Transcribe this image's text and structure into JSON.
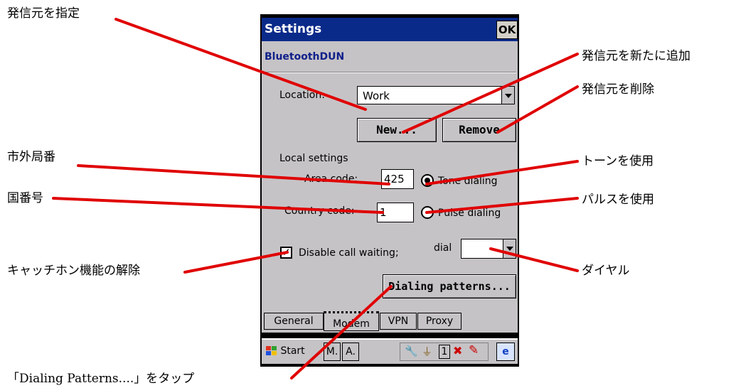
{
  "window": {
    "title": "Settings",
    "ok_label": "OK"
  },
  "connection_name": "BluetoothDUN",
  "location": {
    "label": "Location:",
    "value": "Work"
  },
  "buttons": {
    "new_label": "New...",
    "remove_label": "Remove",
    "dialing_patterns_label": "Dialing patterns..."
  },
  "local_settings": {
    "heading": "Local settings",
    "area_code_label": "Area code:",
    "area_code_value": "425",
    "country_code_label": "Country code:",
    "country_code_value": "1",
    "tone_label": "Tone dialing",
    "pulse_label": "Pulse dialing",
    "tone_selected": true
  },
  "call_waiting": {
    "label": "Disable call waiting;",
    "checked": true,
    "dial_label": "dial",
    "dial_value": ""
  },
  "tabs": [
    {
      "label": "General",
      "active": false
    },
    {
      "label": "Modem",
      "active": true
    },
    {
      "label": "VPN",
      "active": false
    },
    {
      "label": "Proxy",
      "active": false
    }
  ],
  "taskbar": {
    "start_label": "Start",
    "m_label": "M.",
    "a_label": "A.",
    "tray_number": "1"
  },
  "annotations": {
    "location_select": "発信元を指定",
    "new_location": "発信元を新たに追加",
    "remove_location": "発信元を削除",
    "area_code": "市外局番",
    "tone": "トーンを使用",
    "country_code": "国番号",
    "pulse": "パルスを使用",
    "call_waiting": "キャッチホン機能の解除",
    "dial": "ダイヤル",
    "dialing_patterns": "「Dialing Patterns....」をタップ"
  },
  "colors": {
    "titlebar": "#0a2a8a",
    "panel": "#c6c3c6",
    "pointer": "#e00000"
  }
}
